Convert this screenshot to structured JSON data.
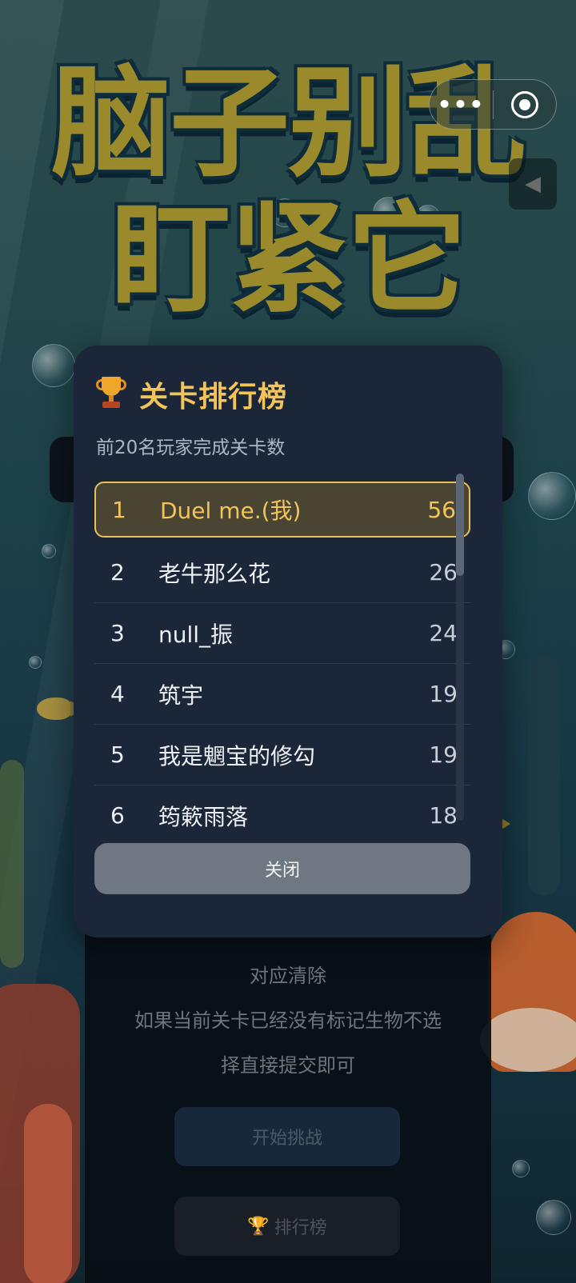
{
  "game": {
    "title_line1": "脑子别乱",
    "title_line2": "盯紧它"
  },
  "capsule": {
    "more_icon": "more-icon",
    "target_icon": "target-icon"
  },
  "sound": {
    "icon": "mute-speaker-icon"
  },
  "background_rules": {
    "line1": "对应清除",
    "line2": "如果当前关卡已经没有标记生物不选",
    "line3": "择直接提交即可",
    "start_button": "开始挑战",
    "rank_button": "排行榜"
  },
  "leaderboard": {
    "title": "关卡排行榜",
    "subtitle": "前20名玩家完成关卡数",
    "close_label": "关闭",
    "rows": [
      {
        "rank": "1",
        "name": "Duel me.(我)",
        "score": "56",
        "is_me": true
      },
      {
        "rank": "2",
        "name": "老牛那么花",
        "score": "26"
      },
      {
        "rank": "3",
        "name": "null_振",
        "score": "24"
      },
      {
        "rank": "4",
        "name": "筑宇",
        "score": "19"
      },
      {
        "rank": "5",
        "name": "我是魍宝的修勾",
        "score": "19"
      },
      {
        "rank": "6",
        "name": "筠簌雨落",
        "score": "18"
      }
    ]
  },
  "colors": {
    "accent_gold": "#f3c45a",
    "modal_bg": "#1b2638",
    "close_button": "#6e7782"
  }
}
